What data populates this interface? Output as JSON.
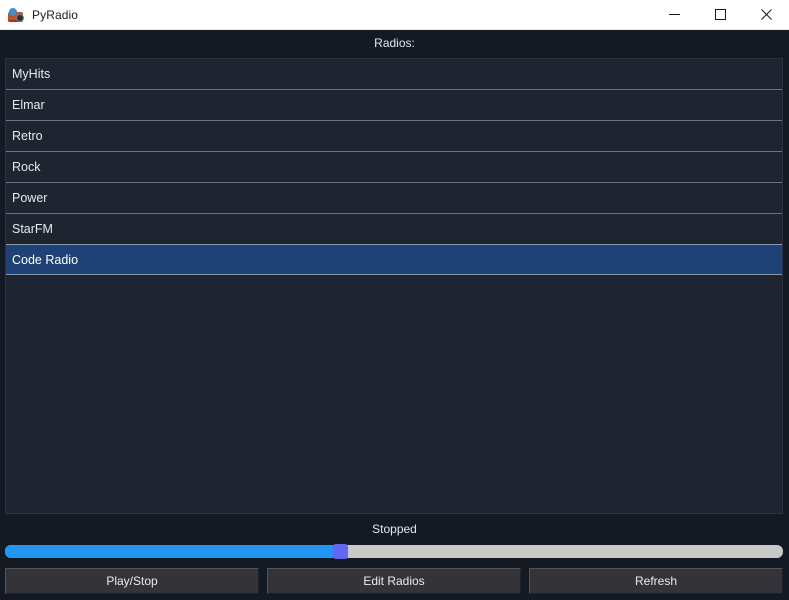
{
  "window": {
    "title": "PyRadio",
    "icon": "radio-app-icon",
    "controls": {
      "minimize": "minimize-icon",
      "maximize": "maximize-icon",
      "close": "close-icon"
    }
  },
  "main": {
    "list_header": "Radios:",
    "radios": [
      {
        "name": "MyHits",
        "selected": false
      },
      {
        "name": "Elmar",
        "selected": false
      },
      {
        "name": "Retro",
        "selected": false
      },
      {
        "name": "Rock",
        "selected": false
      },
      {
        "name": "Power",
        "selected": false
      },
      {
        "name": "StarFM",
        "selected": false
      },
      {
        "name": "Code Radio",
        "selected": true
      }
    ]
  },
  "status": {
    "text": "Stopped"
  },
  "volume_slider": {
    "value_percent": 43,
    "fill_color": "#2196f3",
    "handle_color": "#6366f1",
    "track_color": "#c8c8c8"
  },
  "buttons": [
    {
      "label": "Play/Stop"
    },
    {
      "label": "Edit Radios"
    },
    {
      "label": "Refresh"
    }
  ],
  "colors": {
    "page_background": "#131a24",
    "panel_background": "#1e2430",
    "selection_background": "#1e4176",
    "titlebar_background": "#ffffff",
    "text": "#e6eaef"
  }
}
